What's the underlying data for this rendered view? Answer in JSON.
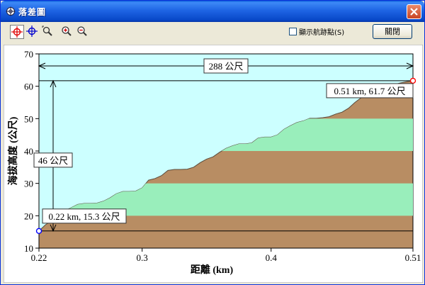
{
  "window": {
    "title": "落差圖",
    "close_label": "關閉"
  },
  "toolbar": {
    "checkbox_label": "顯示航跡點(S)",
    "checkbox_checked": false,
    "tools": [
      "crosshair-select-icon",
      "crosshair-move-icon",
      "zoom-area-icon",
      "zoom-in-icon",
      "zoom-out-icon"
    ]
  },
  "colors": {
    "sky": "#ccffff",
    "ground": "#b88d63",
    "band": "#99eebb",
    "marker": "#0000ff",
    "marker_end": "#ff0000"
  },
  "chart_data": {
    "type": "area",
    "xlabel": "距離 (km)",
    "ylabel": "海拔高度 (公尺)",
    "xlim": [
      0.22,
      0.51
    ],
    "ylim": [
      10,
      70
    ],
    "xticks": [
      0.22,
      0.3,
      0.4,
      0.51
    ],
    "xtick_labels": [
      "0.22",
      "0.3",
      "0.4",
      "0.51"
    ],
    "yticks": [
      10,
      20,
      30,
      40,
      50,
      60,
      70
    ],
    "bands": [
      [
        20,
        30
      ],
      [
        40,
        50
      ]
    ],
    "x": [
      0.22,
      0.225,
      0.23,
      0.235,
      0.24,
      0.245,
      0.25,
      0.255,
      0.26,
      0.265,
      0.27,
      0.275,
      0.28,
      0.285,
      0.29,
      0.295,
      0.3,
      0.305,
      0.31,
      0.315,
      0.32,
      0.325,
      0.33,
      0.335,
      0.34,
      0.345,
      0.35,
      0.355,
      0.36,
      0.365,
      0.37,
      0.375,
      0.38,
      0.385,
      0.39,
      0.395,
      0.4,
      0.405,
      0.41,
      0.415,
      0.42,
      0.425,
      0.43,
      0.435,
      0.44,
      0.445,
      0.45,
      0.455,
      0.46,
      0.465,
      0.47,
      0.475,
      0.48,
      0.485,
      0.49,
      0.495,
      0.5,
      0.505,
      0.51
    ],
    "y": [
      15.3,
      17.2,
      18.5,
      20.0,
      21.5,
      22.5,
      23.5,
      23.8,
      23.8,
      23.9,
      24.5,
      25.5,
      26.8,
      27.5,
      27.5,
      27.6,
      28.6,
      31.0,
      31.5,
      32.4,
      34.0,
      34.3,
      34.3,
      34.4,
      35.0,
      36.4,
      37.5,
      38.2,
      39.6,
      40.8,
      41.6,
      42.2,
      42.2,
      42.5,
      44.0,
      44.3,
      44.3,
      45.0,
      46.7,
      47.8,
      48.8,
      49.3,
      50.1,
      50.1,
      50.3,
      50.6,
      51.4,
      52.0,
      53.2,
      55.0,
      56.5,
      57.8,
      58.5,
      59.3,
      60.0,
      60.5,
      61.0,
      61.4,
      61.7
    ],
    "annotations": {
      "start_label": "0.22 km, 15.3 公尺",
      "end_label": "0.51 km, 61.7 公尺",
      "distance_label": "288 公尺",
      "height_label": "46 公尺"
    },
    "start": {
      "x": 0.22,
      "y": 15.3
    },
    "end": {
      "x": 0.51,
      "y": 61.7
    }
  }
}
